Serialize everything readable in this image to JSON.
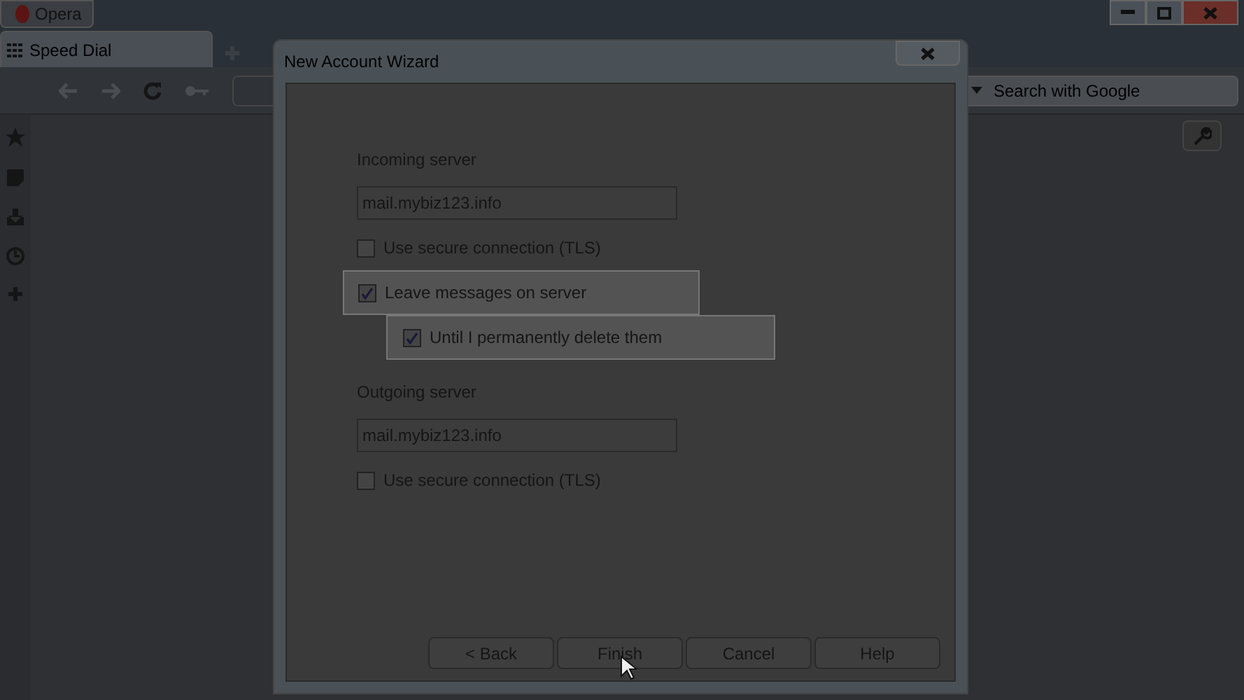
{
  "browser": {
    "menu_button": "Opera",
    "tabs": [
      {
        "label": "Speed Dial",
        "selected": true
      }
    ],
    "search": {
      "placeholder": "Search with Google"
    }
  },
  "dialog": {
    "title": "New Account Wizard",
    "sections": [
      {
        "label": "Incoming server",
        "value": "mail.mybiz123.info",
        "options": [
          {
            "label": "Use secure connection (TLS)",
            "checked": false,
            "highlighted": false
          },
          {
            "label": "Leave messages on server",
            "checked": true,
            "highlighted": true,
            "children": [
              {
                "label": "Until I permanently delete them",
                "checked": true,
                "highlighted": true
              }
            ]
          }
        ]
      },
      {
        "label": "Outgoing server",
        "value": "mail.mybiz123.info",
        "options": [
          {
            "label": "Use secure connection (TLS)",
            "checked": false,
            "highlighted": false
          }
        ]
      }
    ],
    "buttons": [
      "< Back",
      "Finish",
      "Cancel",
      "Help"
    ]
  }
}
